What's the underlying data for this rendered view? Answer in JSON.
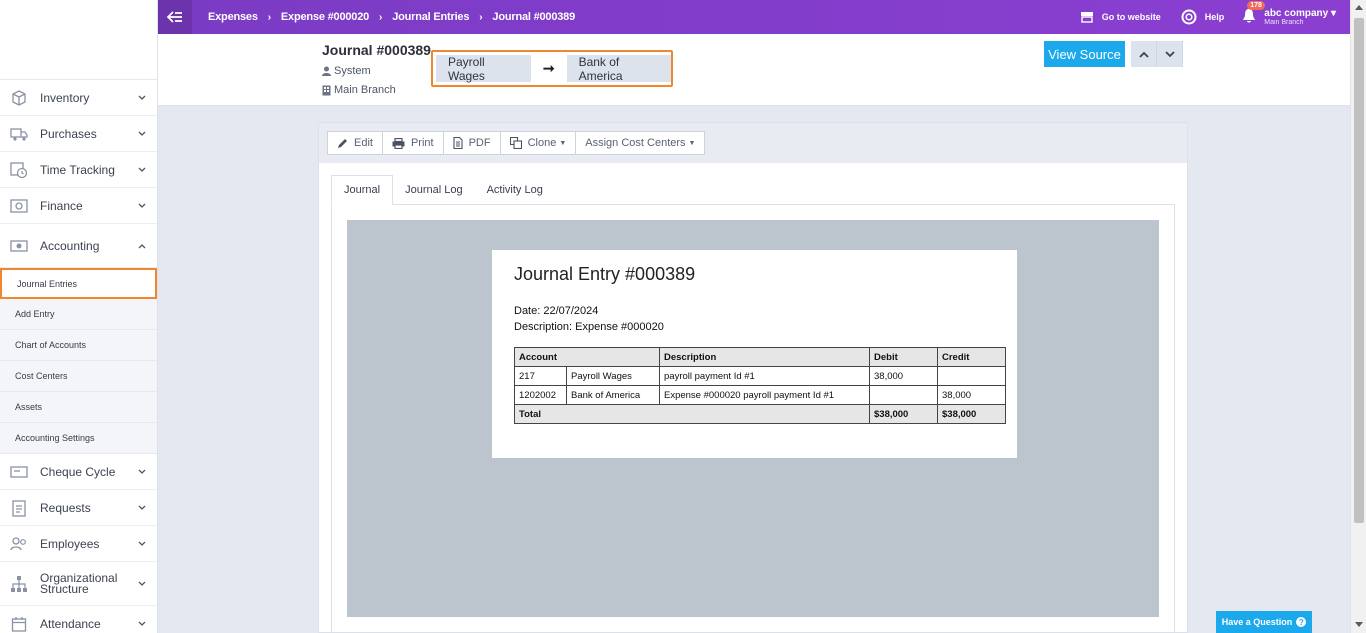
{
  "topbar": {
    "breadcrumbs": [
      "Expenses",
      "Expense #000020",
      "Journal Entries",
      "Journal #000389"
    ],
    "go_to_website": "Go to website",
    "help": "Help",
    "notification_count": "178",
    "company_name": "abc company",
    "company_branch": "Main Branch"
  },
  "sidebar": {
    "items": [
      {
        "label": "Inventory",
        "icon": "box-icon"
      },
      {
        "label": "Purchases",
        "icon": "truck-icon"
      },
      {
        "label": "Time Tracking",
        "icon": "clock-icon"
      },
      {
        "label": "Finance",
        "icon": "safe-icon"
      },
      {
        "label": "Accounting",
        "icon": "money-icon"
      }
    ],
    "accounting_sub": [
      "Journal Entries",
      "Add Entry",
      "Chart of Accounts",
      "Cost Centers",
      "Assets",
      "Accounting Settings"
    ],
    "items_after": [
      {
        "label": "Cheque Cycle",
        "icon": "cheque-icon"
      },
      {
        "label": "Requests",
        "icon": "clipboard-icon"
      },
      {
        "label": "Employees",
        "icon": "users-icon"
      },
      {
        "label": "Organizational Structure",
        "icon": "org-chart-icon"
      },
      {
        "label": "Attendance",
        "icon": "calendar-icon"
      }
    ]
  },
  "header": {
    "title": "Journal #000389",
    "created_by": "System",
    "branch": "Main Branch",
    "flow_from": "Payroll Wages",
    "flow_to": "Bank of America",
    "view_source": "View Source"
  },
  "toolbar": {
    "edit": "Edit",
    "print": "Print",
    "pdf": "PDF",
    "clone": "Clone",
    "assign_cost_centers": "Assign Cost Centers"
  },
  "tabs": [
    "Journal",
    "Journal Log",
    "Activity Log"
  ],
  "document": {
    "title": "Journal Entry #000389",
    "date_line": "Date: 22/07/2024",
    "description_line": "Description: Expense #000020",
    "headers": [
      "Account",
      "Description",
      "Debit",
      "Credit"
    ],
    "rows": [
      {
        "code": "217",
        "name": "Payroll Wages",
        "description": "payroll payment Id #1",
        "debit": "38,000",
        "credit": ""
      },
      {
        "code": "1202002",
        "name": "Bank of America",
        "description": "Expense #000020 payroll payment Id #1",
        "debit": "",
        "credit": "38,000"
      }
    ],
    "total_label": "Total",
    "total_debit": "$38,000",
    "total_credit": "$38,000"
  },
  "have_question": "Have a Question"
}
